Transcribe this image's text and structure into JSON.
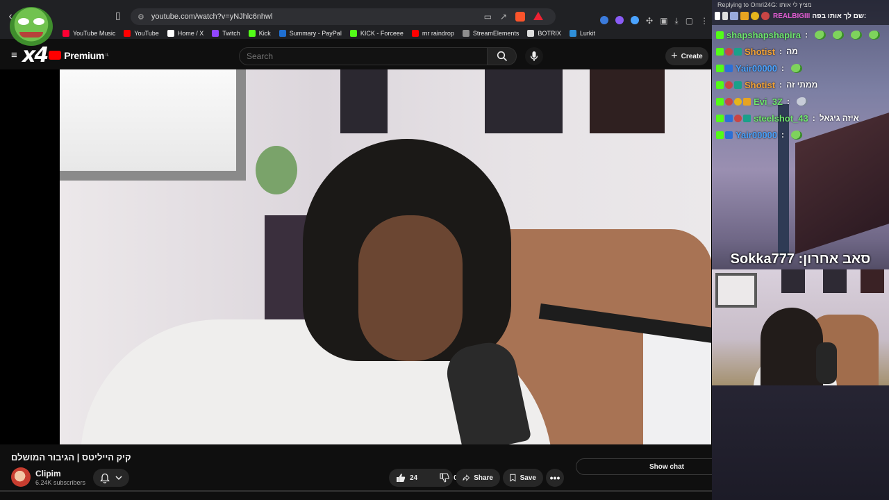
{
  "browser": {
    "url": "youtube.com/watch?v=yNJhlc6nhwl",
    "bookmarks": [
      {
        "label": "YouTube Music",
        "color": "#ff0033"
      },
      {
        "label": "YouTube",
        "color": "#ff0000"
      },
      {
        "label": "Home / X",
        "color": "#ffffff"
      },
      {
        "label": "Twitch",
        "color": "#9146ff"
      },
      {
        "label": "Kick",
        "color": "#53fc18"
      },
      {
        "label": "Summary - PayPal",
        "color": "#1f6fd1"
      },
      {
        "label": "KICK - Forceee",
        "color": "#53fc18"
      },
      {
        "label": "mr raindrop",
        "color": "#ff0000"
      },
      {
        "label": "StreamElements",
        "color": "#8e8e8e"
      },
      {
        "label": "BOTRIX",
        "color": "#dddddd"
      },
      {
        "label": "Lurkit",
        "color": "#2f8fd8"
      }
    ]
  },
  "youtube": {
    "logo_badge": "x4",
    "brand": "Premium",
    "region": "IL",
    "search_placeholder": "Search",
    "create_label": "Create",
    "video_title": "קיק הייליטס | הגיבור המושלם",
    "channel_name": "Clipim",
    "subscribers": "6.24K subscribers",
    "likes": "24",
    "dislikes": "0",
    "share_label": "Share",
    "save_label": "Save",
    "show_chat_label": "Show chat",
    "accent_color": "#ff0000"
  },
  "overlay": {
    "reply_line": "Replying to Omri24G: מציץ לי אותו",
    "pinned_user": "REALBIGIII",
    "pinned_text": ":שם לך אותו בפה",
    "chat": [
      {
        "user": "shapshapshapira",
        "color": "#6ee76e",
        "text": "",
        "emotes": 4,
        "badges": [
          "kick"
        ]
      },
      {
        "user": "Shotist",
        "color": "#f2a235",
        "text": "מה",
        "emotes": 0,
        "badges": [
          "kick",
          "gift",
          "mod"
        ]
      },
      {
        "user": "Yair00000",
        "color": "#4aa3ff",
        "text": "",
        "emotes": 1,
        "badges": [
          "kick",
          "sub"
        ]
      },
      {
        "user": "Shotist",
        "color": "#f2a235",
        "text": "ממתי זה",
        "emotes": 0,
        "badges": [
          "kick",
          "gift",
          "mod"
        ]
      },
      {
        "user": "Evi_3Z",
        "color": "#6ee76e",
        "text": "",
        "emotes": 1,
        "badges": [
          "kick",
          "gift",
          "coin",
          "crown"
        ]
      },
      {
        "user": "steelshot_43",
        "color": "#6ee76e",
        "text": "איזה גיגאל",
        "emotes": 0,
        "badges": [
          "kick",
          "sub",
          "gift",
          "mod"
        ]
      },
      {
        "user": "Yair00000",
        "color": "#4aa3ff",
        "text": "",
        "emotes": 1,
        "badges": [
          "kick",
          "sub"
        ]
      }
    ],
    "last_sub": "סאב אחרון: Sokka777"
  }
}
